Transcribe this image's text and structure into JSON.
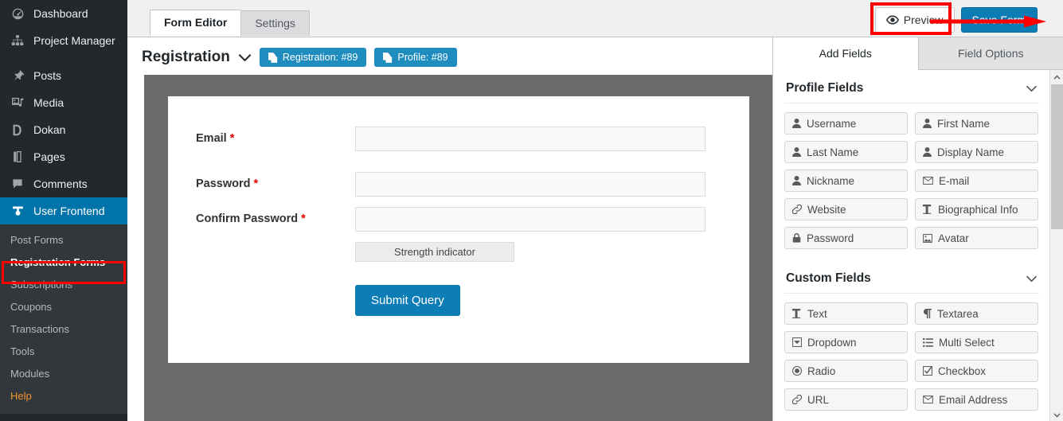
{
  "sidebar": {
    "items": [
      {
        "label": "Dashboard",
        "icon": "dashboard-icon"
      },
      {
        "label": "Project Manager",
        "icon": "sitemap-icon"
      },
      {
        "label": "Posts",
        "icon": "pin-icon"
      },
      {
        "label": "Media",
        "icon": "media-icon"
      },
      {
        "label": "Dokan",
        "icon": "dokan-icon"
      },
      {
        "label": "Pages",
        "icon": "pages-icon"
      },
      {
        "label": "Comments",
        "icon": "comment-icon"
      },
      {
        "label": "User Frontend",
        "icon": "user-frontend-icon",
        "active": true
      }
    ],
    "submenu": [
      {
        "label": "Post Forms"
      },
      {
        "label": "Registration Forms",
        "current": true
      },
      {
        "label": "Subscriptions"
      },
      {
        "label": "Coupons"
      },
      {
        "label": "Transactions"
      },
      {
        "label": "Tools"
      },
      {
        "label": "Modules"
      },
      {
        "label": "Help",
        "style": "help"
      }
    ]
  },
  "topbar": {
    "tabs": [
      {
        "label": "Form Editor",
        "active": true
      },
      {
        "label": "Settings",
        "active": false
      }
    ],
    "preview_label": "Preview",
    "save_label": "Save Form",
    "highlight_color": "#ff0000",
    "accent_color": "#0c7db5"
  },
  "main": {
    "form_title": "Registration",
    "badges": [
      {
        "label": "Registration: #89"
      },
      {
        "label": "Profile: #89"
      }
    ],
    "fields": [
      {
        "label": "Email",
        "required": "*",
        "value": "",
        "placeholder": ""
      },
      {
        "label": "Password",
        "required": "*",
        "value": "",
        "placeholder": ""
      },
      {
        "label": "Confirm Password",
        "required": "*",
        "value": "",
        "placeholder": ""
      }
    ],
    "strength_indicator": "Strength indicator",
    "submit_label": "Submit Query"
  },
  "rightpanel": {
    "tabs": [
      {
        "label": "Add Fields",
        "active": true
      },
      {
        "label": "Field Options",
        "active": false
      }
    ],
    "sections": [
      {
        "title": "Profile Fields",
        "chips": [
          {
            "label": "Username",
            "icon": "user-icon"
          },
          {
            "label": "First Name",
            "icon": "user-icon"
          },
          {
            "label": "Last Name",
            "icon": "user-icon"
          },
          {
            "label": "Display Name",
            "icon": "user-icon"
          },
          {
            "label": "Nickname",
            "icon": "user-icon"
          },
          {
            "label": "E-mail",
            "icon": "envelope-icon"
          },
          {
            "label": "Website",
            "icon": "link-icon"
          },
          {
            "label": "Biographical Info",
            "icon": "text-height-icon"
          },
          {
            "label": "Password",
            "icon": "lock-icon"
          },
          {
            "label": "Avatar",
            "icon": "image-icon"
          }
        ]
      },
      {
        "title": "Custom Fields",
        "chips": [
          {
            "label": "Text",
            "icon": "text-height-icon"
          },
          {
            "label": "Textarea",
            "icon": "paragraph-icon"
          },
          {
            "label": "Dropdown",
            "icon": "dropdown-icon"
          },
          {
            "label": "Multi Select",
            "icon": "list-icon"
          },
          {
            "label": "Radio",
            "icon": "radio-icon"
          },
          {
            "label": "Checkbox",
            "icon": "checkbox-icon"
          },
          {
            "label": "URL",
            "icon": "link-icon"
          },
          {
            "label": "Email Address",
            "icon": "envelope-icon"
          }
        ]
      }
    ]
  }
}
